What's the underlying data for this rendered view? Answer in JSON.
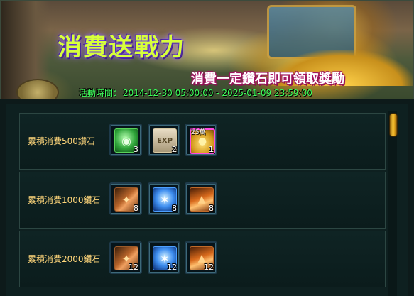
{
  "banner": {
    "title": "消費送戰力",
    "subtitle": "消費一定鑽石即可領取獎勵",
    "time_label": "活動時間：",
    "time_range": "2014-12-30 05:00:00 - 2025-01-09 23:59:00"
  },
  "tiers": [
    {
      "label": "累積消費500鑽石",
      "rewards": [
        {
          "icon": "green-gem-icon",
          "count": "3"
        },
        {
          "icon": "exp-scroll-icon",
          "count": "2"
        },
        {
          "icon": "gold-coin-bag-icon",
          "badge": "25萬",
          "count": "1"
        }
      ]
    },
    {
      "label": "累積消費1000鑽石",
      "rewards": [
        {
          "icon": "orange-scroll-icon",
          "count": "8"
        },
        {
          "icon": "blue-crystal-icon",
          "count": "8"
        },
        {
          "icon": "orange-potion-icon",
          "count": "8"
        }
      ]
    },
    {
      "label": "累積消費2000鑽石",
      "rewards": [
        {
          "icon": "orange-scroll-icon",
          "count": "12"
        },
        {
          "icon": "blue-crystal-icon",
          "count": "12"
        },
        {
          "icon": "orange-potion-icon",
          "count": "12"
        }
      ]
    }
  ],
  "colors": {
    "label": "#ffd67a",
    "time_text": "#3cff5a",
    "title": "#d7ff3a",
    "scroll_thumb": "#ffcc3a"
  }
}
